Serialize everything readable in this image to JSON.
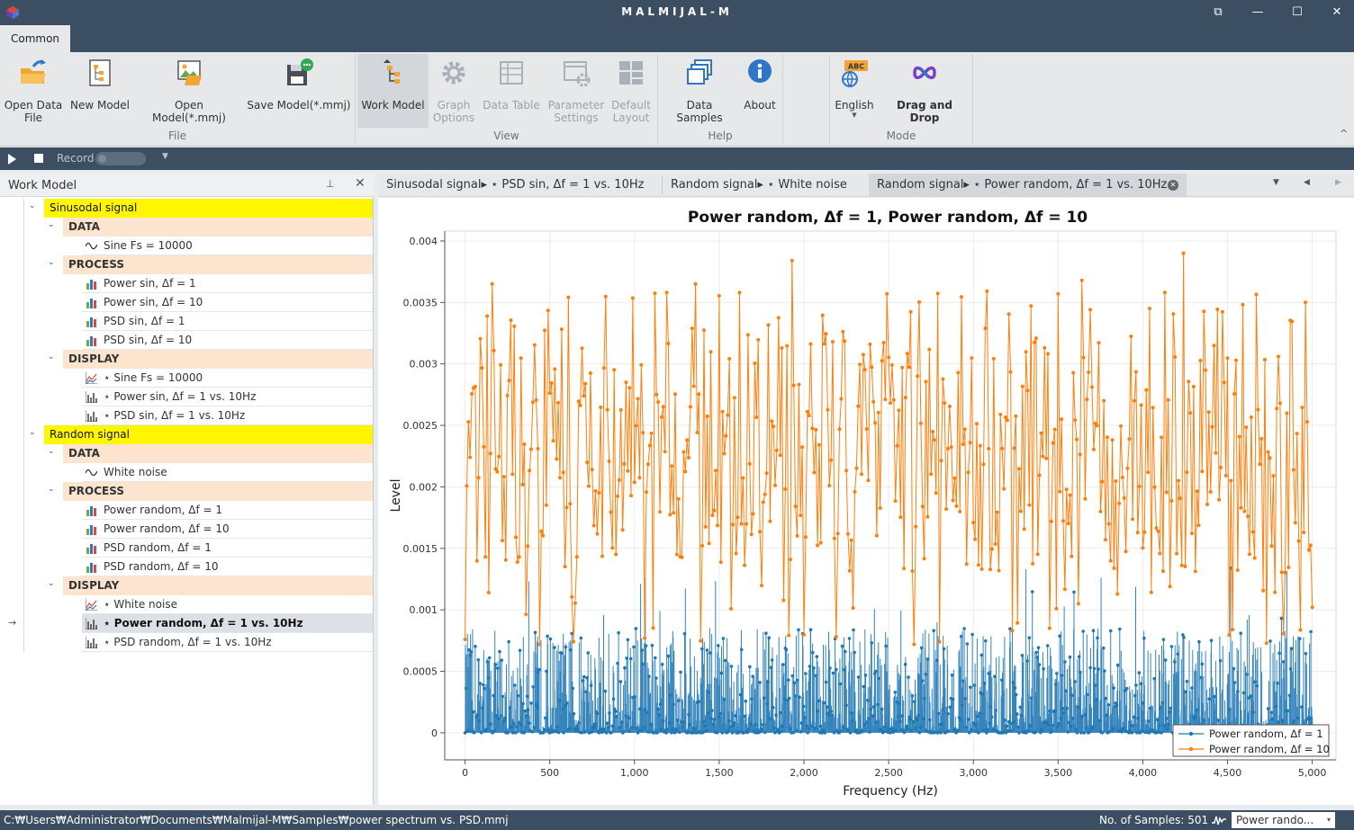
{
  "window": {
    "title": "MALMIJAL-M",
    "buttons": [
      "⧉",
      "—",
      "☐",
      "✕"
    ]
  },
  "ribbon": {
    "tab": "Common",
    "groups": {
      "file": "File",
      "view": "View",
      "help": "Help",
      "mode": "Mode"
    },
    "buttons": {
      "open_data_file": "Open Data\nFile",
      "new_model": "New Model",
      "open_model": "Open Model(*.mmj)",
      "save_model": "Save Model(*.mmj)",
      "work_model": "Work Model",
      "graph_options": "Graph\nOptions",
      "data_table": "Data Table",
      "parameter_settings": "Parameter\nSettings",
      "default_layout": "Default\nLayout",
      "data_samples": "Data Samples",
      "about": "About",
      "english": "English",
      "drag_and_drop": "Drag and Drop",
      "language_badge": "ABC"
    },
    "collapse_glyph": "^"
  },
  "recordbar": {
    "record_label": "Record"
  },
  "work_model": {
    "title": "Work Model",
    "pin_glyph": "📌",
    "close_glyph": "✕",
    "tree": [
      {
        "type": "group",
        "label": "Sinusodal signal"
      },
      {
        "type": "section",
        "label": "DATA"
      },
      {
        "type": "item",
        "icon": "wave",
        "label": "Sine Fs = 10000"
      },
      {
        "type": "section",
        "label": "PROCESS"
      },
      {
        "type": "item",
        "icon": "bars",
        "label": "Power sin, Δf = 1"
      },
      {
        "type": "item",
        "icon": "bars",
        "label": "Power sin, Δf = 10"
      },
      {
        "type": "item",
        "icon": "bars",
        "label": "PSD sin, Δf = 1"
      },
      {
        "type": "item",
        "icon": "bars",
        "label": "PSD sin, Δf = 10"
      },
      {
        "type": "section",
        "label": "DISPLAY"
      },
      {
        "type": "item",
        "icon": "line",
        "label": "⋆ Sine Fs = 10000"
      },
      {
        "type": "item",
        "icon": "stem",
        "label": "⋆ Power sin, Δf = 1 vs. 10Hz"
      },
      {
        "type": "item",
        "icon": "stem",
        "label": "⋆ PSD sin, Δf = 1 vs. 10Hz"
      },
      {
        "type": "group",
        "label": "Random signal"
      },
      {
        "type": "section",
        "label": "DATA"
      },
      {
        "type": "item",
        "icon": "wave",
        "label": "White noise"
      },
      {
        "type": "section",
        "label": "PROCESS"
      },
      {
        "type": "item",
        "icon": "bars",
        "label": "Power random, Δf = 1"
      },
      {
        "type": "item",
        "icon": "bars",
        "label": "Power random, Δf = 10"
      },
      {
        "type": "item",
        "icon": "bars",
        "label": "PSD random, Δf = 1"
      },
      {
        "type": "item",
        "icon": "bars",
        "label": "PSD random, Δf = 10"
      },
      {
        "type": "section",
        "label": "DISPLAY"
      },
      {
        "type": "item",
        "icon": "line",
        "label": "⋆ White noise"
      },
      {
        "type": "item",
        "icon": "stem",
        "label": "⋆ Power random, Δf = 1 vs. 10Hz",
        "selected": true
      },
      {
        "type": "item",
        "icon": "stem",
        "label": "⋆ PSD random, Δf = 1 vs. 10Hz"
      }
    ]
  },
  "doc_tabs": [
    {
      "label": "Sinusodal signal▸ ⋆ PSD sin, Δf = 1 vs. 10Hz",
      "active": false
    },
    {
      "label": "Random signal▸ ⋆ White noise",
      "active": false
    },
    {
      "label": "Random signal▸ ⋆ Power random, Δf = 1 vs. 10Hz",
      "active": true
    }
  ],
  "chart_data": {
    "type": "line",
    "title": "Power random, Δf = 1, Power random, Δf = 10",
    "xlabel": "Frequency (Hz)",
    "ylabel": "Level",
    "xlim": [
      -120,
      5140
    ],
    "ylim": [
      -0.00022,
      0.00408
    ],
    "x_ticks": [
      0,
      500,
      1000,
      1500,
      2000,
      2500,
      3000,
      3500,
      4000,
      4500,
      5000
    ],
    "x_tick_labels": [
      "0",
      "500",
      "1,000",
      "1,500",
      "2,000",
      "2,500",
      "3,000",
      "3,500",
      "4,000",
      "4,500",
      "5,000"
    ],
    "y_ticks": [
      0,
      0.0005,
      0.001,
      0.0015,
      0.002,
      0.0025,
      0.003,
      0.0035,
      0.004
    ],
    "y_tick_labels": [
      "0",
      "0.0005",
      "0.001",
      "0.0015",
      "0.002",
      "0.0025",
      "0.003",
      "0.0035",
      "0.004"
    ],
    "grid": true,
    "legend_position": "bottom-right",
    "series": [
      {
        "name": "Power random, Δf = 1",
        "color": "#1f77b4",
        "style": "stem",
        "x_range": [
          0,
          5000
        ],
        "n_points": 5001,
        "typical_range": [
          0,
          0.0005
        ],
        "peak": 0.00135
      },
      {
        "name": "Power random, Δf = 10",
        "color": "#ff7f0e",
        "style": "line-markers",
        "x_step": 10,
        "x_range": [
          0,
          5000
        ],
        "n_points": 501,
        "highlights": [
          {
            "x": 0,
            "y": 0.00076
          },
          {
            "x": 160,
            "y": 0.00365
          },
          {
            "x": 1360,
            "y": 0.00365
          },
          {
            "x": 1930,
            "y": 0.00384
          },
          {
            "x": 3640,
            "y": 0.00368
          },
          {
            "x": 4240,
            "y": 0.0039
          },
          {
            "x": 4960,
            "y": 0.0035
          },
          {
            "x": 5000,
            "y": 0.00102
          }
        ],
        "typical_range": [
          0.0013,
          0.0032
        ]
      }
    ]
  },
  "status": {
    "path": "C:₩Users₩Administrator₩Documents₩Malmijal-M₩Samples₩power spectrum vs. PSD.mmj",
    "samples": "No. of Samples: 501",
    "combo_value": "Power rando...",
    "combo_glyph": "▾"
  }
}
